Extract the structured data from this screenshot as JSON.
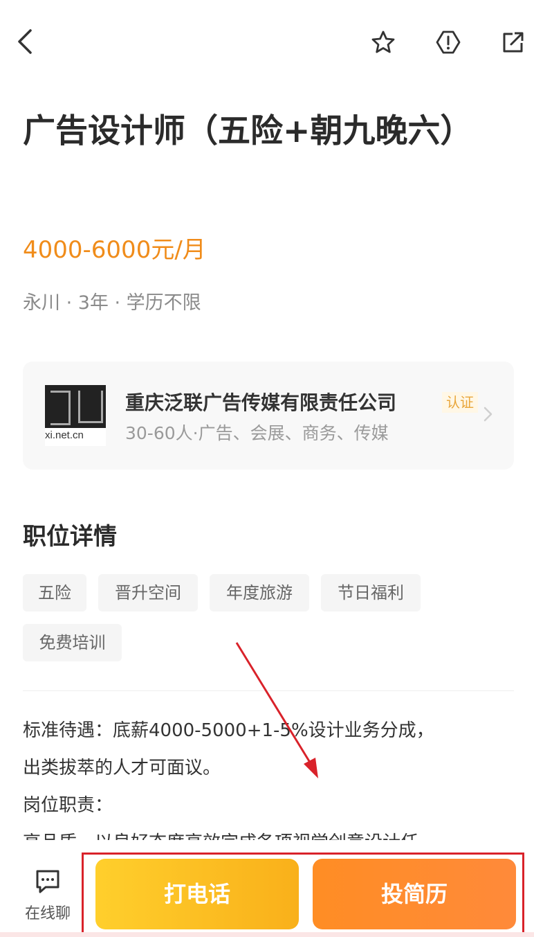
{
  "topbar": {
    "back_icon": "chevron-left-icon",
    "favorite_icon": "star-outline-icon",
    "report_icon": "warning-hexagon-icon",
    "share_icon": "external-link-icon"
  },
  "job": {
    "title": "广告设计师（五险+朝九晚六）",
    "salary": "4000-6000元/月",
    "meta": "永川 · 3年 ·  学历不限"
  },
  "company": {
    "logo_text": "xi.net.cn",
    "name": "重庆泛联广告传媒有限责任公司",
    "badge": "认证",
    "desc": "30-60人·广告、会展、商务、传媒"
  },
  "details": {
    "section_title": "职位详情",
    "tags": [
      "五险",
      "晋升空间",
      "年度旅游",
      "节日福利",
      "免费培训"
    ],
    "description": [
      "标准待遇：底薪4000-5000+1-5%设计业务分成，",
      "出类拔萃的人才可面议。",
      "岗位职责：",
      "高品质、以良好态度高效完成各项视觉创意设计任"
    ]
  },
  "bottom": {
    "chat_label": "在线聊",
    "call_label": "打电话",
    "resume_label": "投简历"
  },
  "colors": {
    "salary": "#f08c1a",
    "call_button": "#f9b01a",
    "resume_button": "#ff8a3a",
    "annotation": "#d9222a"
  }
}
